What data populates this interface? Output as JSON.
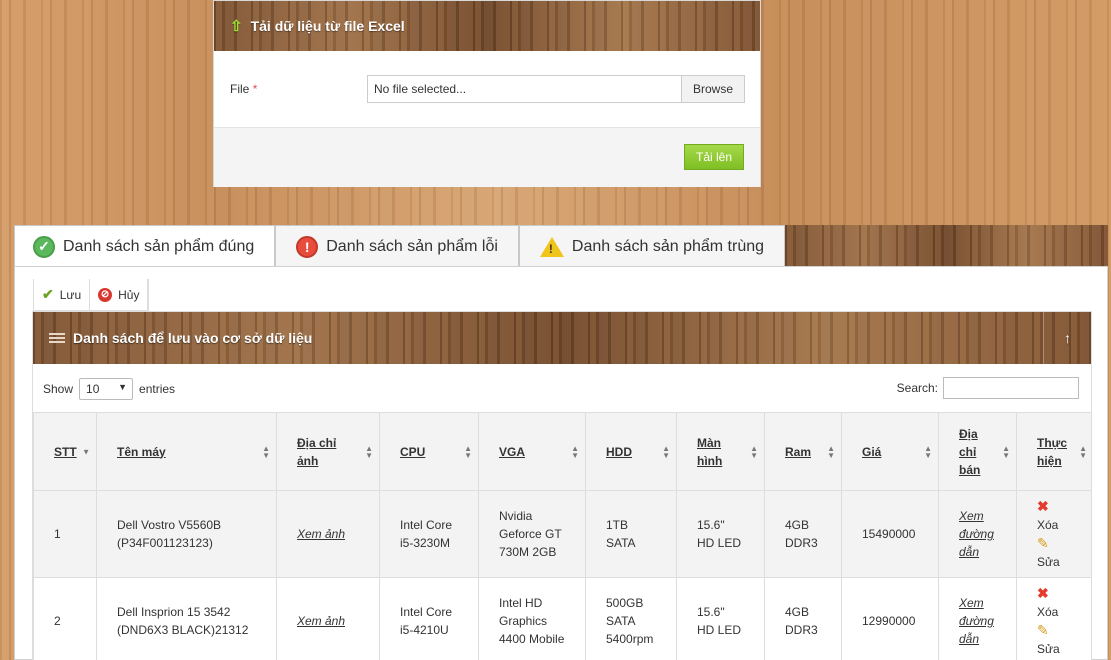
{
  "upload": {
    "title": "Tải dữ liệu từ file Excel",
    "file_label": "File",
    "required_mark": "*",
    "file_placeholder": "No file selected...",
    "browse_label": "Browse",
    "submit_label": "Tải lên"
  },
  "tabs": [
    {
      "label": "Danh sách sản phẩm đúng",
      "icon": "check-circle-icon"
    },
    {
      "label": "Danh sách sản phẩm lỗi",
      "icon": "error-circle-icon"
    },
    {
      "label": "Danh sách sản phẩm trùng",
      "icon": "warning-triangle-icon"
    }
  ],
  "toolbar": {
    "save_label": "Lưu",
    "cancel_label": "Hủy"
  },
  "panel": {
    "title": "Danh sách để lưu vào cơ sở dữ liệu"
  },
  "datatable": {
    "show_label": "Show",
    "page_size": "10",
    "entries_label": "entries",
    "search_label": "Search:"
  },
  "table": {
    "headers": [
      "STT",
      "Tên máy",
      "Địa chỉ ảnh",
      "CPU",
      "VGA",
      "HDD",
      "Màn hình",
      "Ram",
      "Giá",
      "Địa chỉ bán",
      "Thực hiện"
    ],
    "rows": [
      {
        "stt": "1",
        "name": "Dell Vostro V5560B (P34F001123123)",
        "image_link": "Xem ảnh",
        "cpu": "Intel Core i5-3230M",
        "vga": "Nvidia Geforce GT 730M 2GB",
        "hdd": "1TB SATA",
        "screen": "15.6\" HD LED",
        "ram": "4GB DDR3",
        "price": "15490000",
        "seller_link": "Xem đường dẫn",
        "delete_label": "Xóa",
        "edit_label": "Sửa"
      },
      {
        "stt": "2",
        "name": "Dell Insprion 15 3542 (DND6X3 BLACK)21312",
        "image_link": "Xem ảnh",
        "cpu": "Intel Core i5-4210U",
        "vga": "Intel HD Graphics 4400 Mobile",
        "hdd": "500GB SATA 5400rpm",
        "screen": "15.6\" HD LED",
        "ram": "4GB DDR3",
        "price": "12990000",
        "seller_link": "Xem đường dẫn",
        "delete_label": "Xóa",
        "edit_label": "Sửa"
      }
    ]
  }
}
